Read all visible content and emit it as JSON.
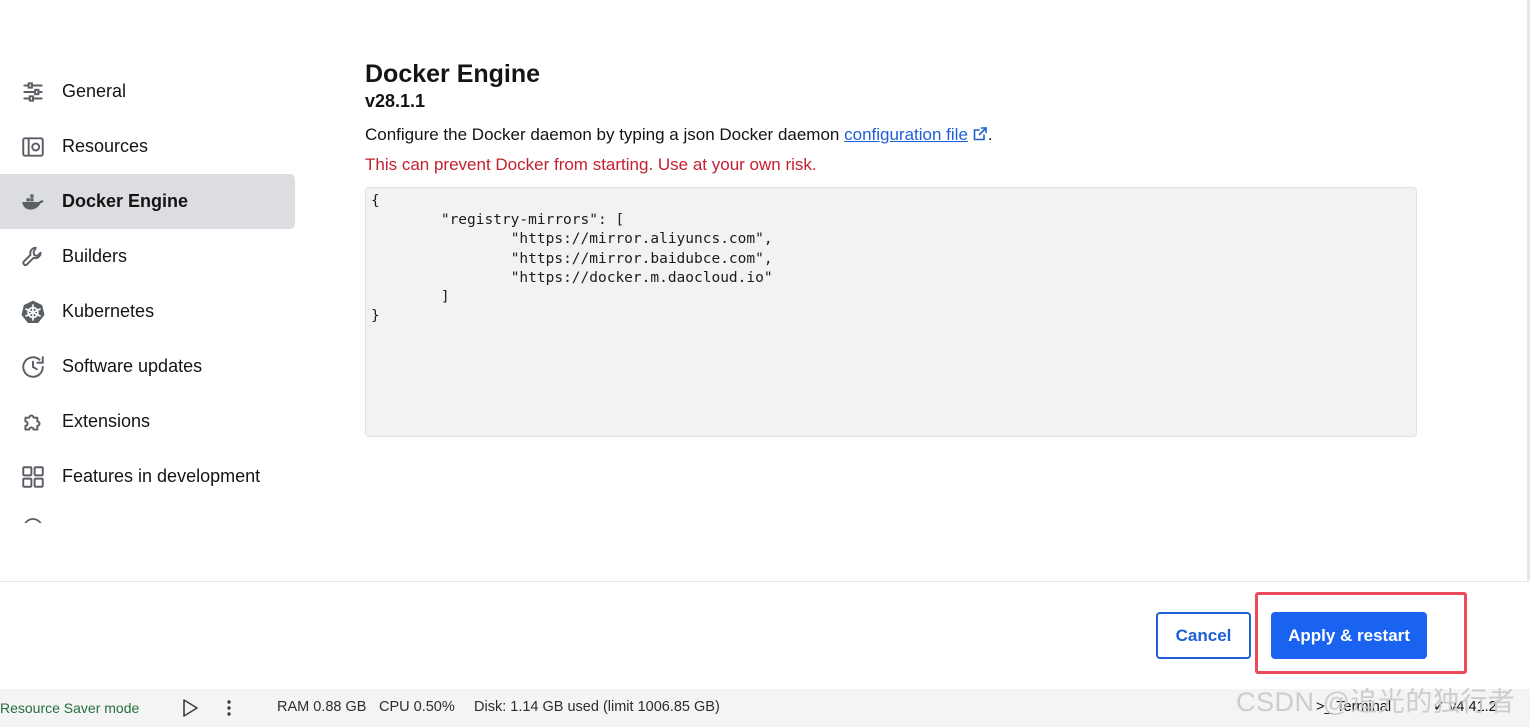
{
  "sidebar": {
    "items": [
      {
        "label": "General",
        "icon": "sliders-icon"
      },
      {
        "label": "Resources",
        "icon": "resources-icon"
      },
      {
        "label": "Docker Engine",
        "icon": "docker-whale-icon",
        "active": true
      },
      {
        "label": "Builders",
        "icon": "wrench-icon"
      },
      {
        "label": "Kubernetes",
        "icon": "kubernetes-helm-icon"
      },
      {
        "label": "Software updates",
        "icon": "clock-history-icon"
      },
      {
        "label": "Extensions",
        "icon": "puzzle-icon"
      },
      {
        "label": "Features in development",
        "icon": "grid-icon"
      }
    ]
  },
  "main": {
    "title": "Docker Engine",
    "version": "v28.1.1",
    "description_prefix": "Configure the Docker daemon by typing a json Docker daemon ",
    "config_link": "configuration file",
    "description_suffix": ".",
    "warning": "This can prevent Docker from starting. Use at your own risk.",
    "daemon_json": "{\n\t\"registry-mirrors\": [\n\t\t\"https://mirror.aliyuncs.com\",\n\t\t\"https://mirror.baidubce.com\",\n\t\t\"https://docker.m.daocloud.io\"\n\t]\n}"
  },
  "footer": {
    "cancel_label": "Cancel",
    "apply_label": "Apply & restart"
  },
  "statusbar": {
    "mode": "Resource Saver mode",
    "ram": "RAM 0.88 GB",
    "cpu": "CPU 0.50%",
    "disk": "Disk: 1.14 GB used (limit 1006.85 GB)",
    "terminal": ">_ Terminal",
    "version": "✓ v4.41.2"
  },
  "watermark": "CSDN @追光的独行者",
  "colors": {
    "accent": "#1a63f0",
    "link": "#1f5fd6",
    "warning": "#c4202f",
    "highlight_box": "#ec4a5a",
    "resource_saver": "#256f3a"
  }
}
